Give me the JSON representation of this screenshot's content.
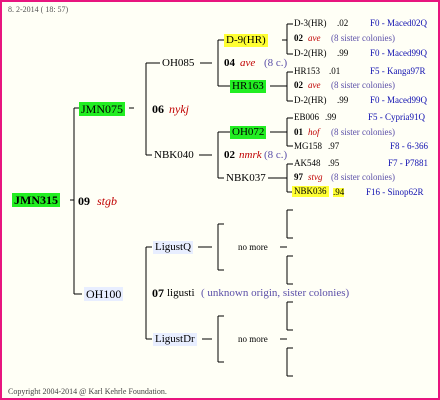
{
  "header": {
    "date": "8. 2-2014 ( 18: 57)"
  },
  "footer": {
    "copyright": "Copyright 2004-2014 @ Karl Kehrle Foundation."
  },
  "colors": {
    "border": "#e8157f",
    "green": "#22ee22",
    "yellow": "#ffff33",
    "lightblue": "#e8eeff",
    "red": "#c00000",
    "blue": "#1010b0"
  },
  "gen1": {
    "name": "JMN315"
  },
  "gen2": [
    {
      "name": "JMN075",
      "year": "09",
      "mark": "stgb"
    },
    {
      "name": "OH100",
      "year": "07",
      "mark": "ligusti",
      "note": "( unknown origin, sister colonies)"
    }
  ],
  "gen3": [
    {
      "name": "OH085",
      "year": "06",
      "mark": "nykj"
    },
    {
      "name": "NBK040"
    },
    {
      "name": "LigustQ"
    },
    {
      "name": "LigustDr"
    }
  ],
  "gen4": [
    {
      "name": "D-9(HR)",
      "year": "04",
      "mark": "ave",
      "note": "(8 c.)"
    },
    {
      "name": "HR163"
    },
    {
      "name": "OH072",
      "year": "02",
      "mark": "nmrk",
      "note": "(8 c.)"
    },
    {
      "name": "NBK037"
    },
    {
      "name": "no more"
    },
    {
      "name": "no more"
    }
  ],
  "gen5": [
    {
      "name": "D-3(HR)",
      "val": ".02",
      "code": "F0 - Maced02Q"
    },
    {
      "year": "02",
      "mark": "ave",
      "note": "(8 sister colonies)"
    },
    {
      "name": "D-2(HR)",
      "val": ".99",
      "code": "F0 - Maced99Q"
    },
    {
      "name": "HR153",
      "val": ".01",
      "code": "F5 - Kanga97R"
    },
    {
      "year": "02",
      "mark": "ave",
      "note": "(8 sister colonies)"
    },
    {
      "name": "D-2(HR)",
      "val": ".99",
      "code": "F0 - Maced99Q"
    },
    {
      "name": "EB006",
      "val": ".99",
      "code": "F5 - Cypria91Q"
    },
    {
      "year": "01",
      "mark": "hof",
      "note": "(8 sister colonies)"
    },
    {
      "name": "MG158",
      "val": ".97",
      "code": "F8 - 6-366"
    },
    {
      "name": "AK548",
      "val": ".95",
      "code": "F7 - P7881"
    },
    {
      "year": "97",
      "mark": "stvg",
      "note": "(8 sister colonies)"
    },
    {
      "name": "NBK036",
      "val": ".94",
      "code": "F16 - Sinop62R"
    }
  ]
}
